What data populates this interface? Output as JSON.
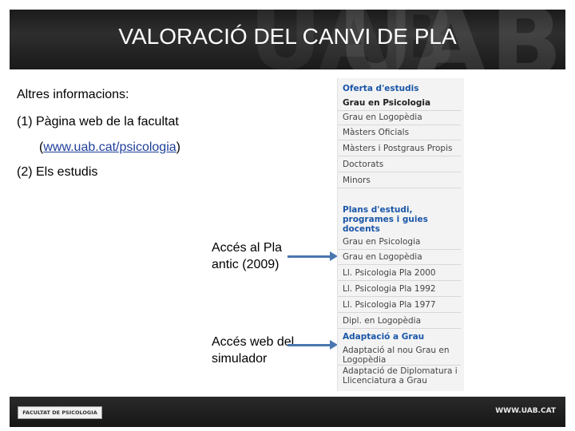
{
  "slide": {
    "title": "VALORACIÓ DEL CANVI DE PLA",
    "header_watermark": "UAB",
    "body": {
      "heading": "Altres informacions:",
      "item1": "(1) Pàgina web de la facultat",
      "item1_link_open": "(",
      "item1_link": "www.uab.cat/psicologia",
      "item1_link_close": ")",
      "item2": "(2) Els estudis",
      "callout1_line1": "Accés al Pla",
      "callout1_line2": "antic (2009)",
      "callout2_line1": "Accés web del",
      "callout2_line2": "simulador"
    },
    "arrow_color": "#4a76b0",
    "footer": {
      "logo_text": "FACULTAT DE PSICOLOGIA",
      "url": "WWW.UAB.CAT"
    }
  },
  "menu": {
    "section1_title": "Oferta d'estudis",
    "section1_items": [
      "Grau en Psicologia",
      "Grau en Logopèdia",
      "Màsters Oficials",
      "Màsters i Postgraus Propis",
      "Doctorats",
      "Minors"
    ],
    "section2_title": "Plans d'estudi, programes i guies docents",
    "section2_items": [
      "Grau en Psicologia",
      "Grau en Logopèdia",
      "Ll. Psicologia Pla 2000",
      "Ll. Psicologia Pla 1992",
      "Ll. Psicologia Pla 1977",
      "Dipl. en Logopèdia"
    ],
    "section3_title": "Adaptació a Grau",
    "section3_items": [
      "Adaptació al nou Grau en Logopèdia",
      "Adaptació de Diplomatura i Llicenciatura a Grau"
    ],
    "link_color": "#1a56a8"
  }
}
